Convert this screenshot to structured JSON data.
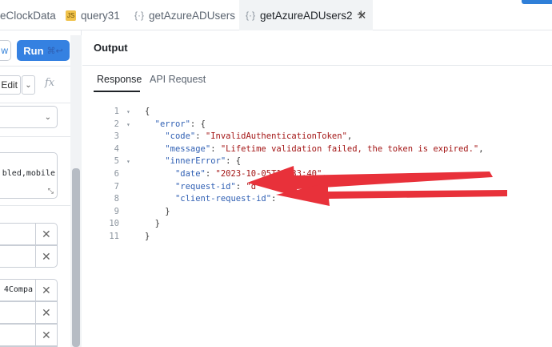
{
  "tabs": [
    {
      "icon": "clock-icon",
      "label": "eClockData"
    },
    {
      "icon": "js-icon",
      "label": "query31"
    },
    {
      "icon": "braces-icon",
      "label": "getAzureADUsers"
    },
    {
      "icon": "braces-icon",
      "label": "getAzureADUsers2"
    }
  ],
  "left_panel": {
    "preview_label": "w",
    "run_label": "Run",
    "run_shortcut": "⌘↩",
    "edit_label": "Edit",
    "fx_label": "fx",
    "text_value": "bled,mobile",
    "kv_value": "4Compa"
  },
  "output": {
    "title": "Output",
    "subtabs": [
      "Response",
      "API Request"
    ],
    "active_subtab": "Response",
    "lines": [
      {
        "n": "1",
        "fold": true,
        "tokens": [
          {
            "t": "{",
            "c": "p"
          }
        ]
      },
      {
        "n": "2",
        "fold": true,
        "tokens": [
          {
            "t": "  ",
            "c": "p"
          },
          {
            "t": "\"error\"",
            "c": "k"
          },
          {
            "t": ": {",
            "c": "p"
          }
        ]
      },
      {
        "n": "3",
        "fold": false,
        "tokens": [
          {
            "t": "    ",
            "c": "p"
          },
          {
            "t": "\"code\"",
            "c": "k"
          },
          {
            "t": ": ",
            "c": "p"
          },
          {
            "t": "\"InvalidAuthenticationToken\"",
            "c": "s"
          },
          {
            "t": ",",
            "c": "p"
          }
        ]
      },
      {
        "n": "4",
        "fold": false,
        "tokens": [
          {
            "t": "    ",
            "c": "p"
          },
          {
            "t": "\"message\"",
            "c": "k"
          },
          {
            "t": ": ",
            "c": "p"
          },
          {
            "t": "\"Lifetime validation failed, the token is expired.\"",
            "c": "s"
          },
          {
            "t": ",",
            "c": "p"
          }
        ]
      },
      {
        "n": "5",
        "fold": true,
        "tokens": [
          {
            "t": "    ",
            "c": "p"
          },
          {
            "t": "\"innerError\"",
            "c": "k"
          },
          {
            "t": ": {",
            "c": "p"
          }
        ]
      },
      {
        "n": "6",
        "fold": false,
        "tokens": [
          {
            "t": "      ",
            "c": "p"
          },
          {
            "t": "\"date\"",
            "c": "k"
          },
          {
            "t": ": ",
            "c": "p"
          },
          {
            "t": "\"2023-10-05T15:33:40\"",
            "c": "s"
          },
          {
            "t": ",",
            "c": "p"
          }
        ]
      },
      {
        "n": "7",
        "fold": false,
        "tokens": [
          {
            "t": "      ",
            "c": "p"
          },
          {
            "t": "\"request-id\"",
            "c": "k"
          },
          {
            "t": ": ",
            "c": "p"
          },
          {
            "t": "\"d",
            "c": "s"
          }
        ]
      },
      {
        "n": "8",
        "fold": false,
        "tokens": [
          {
            "t": "      ",
            "c": "p"
          },
          {
            "t": "\"client-request-id\"",
            "c": "k"
          },
          {
            "t": ": ",
            "c": "p"
          }
        ]
      },
      {
        "n": "9",
        "fold": false,
        "tokens": [
          {
            "t": "    }",
            "c": "p"
          }
        ]
      },
      {
        "n": "10",
        "fold": false,
        "tokens": [
          {
            "t": "  }",
            "c": "p"
          }
        ]
      },
      {
        "n": "11",
        "fold": false,
        "tokens": [
          {
            "t": "}",
            "c": "p"
          }
        ]
      }
    ]
  },
  "colors": {
    "accent": "#3581e1",
    "json_key": "#2f5fb3",
    "json_string": "#a31515",
    "annotation_arrow": "#e8313a"
  }
}
